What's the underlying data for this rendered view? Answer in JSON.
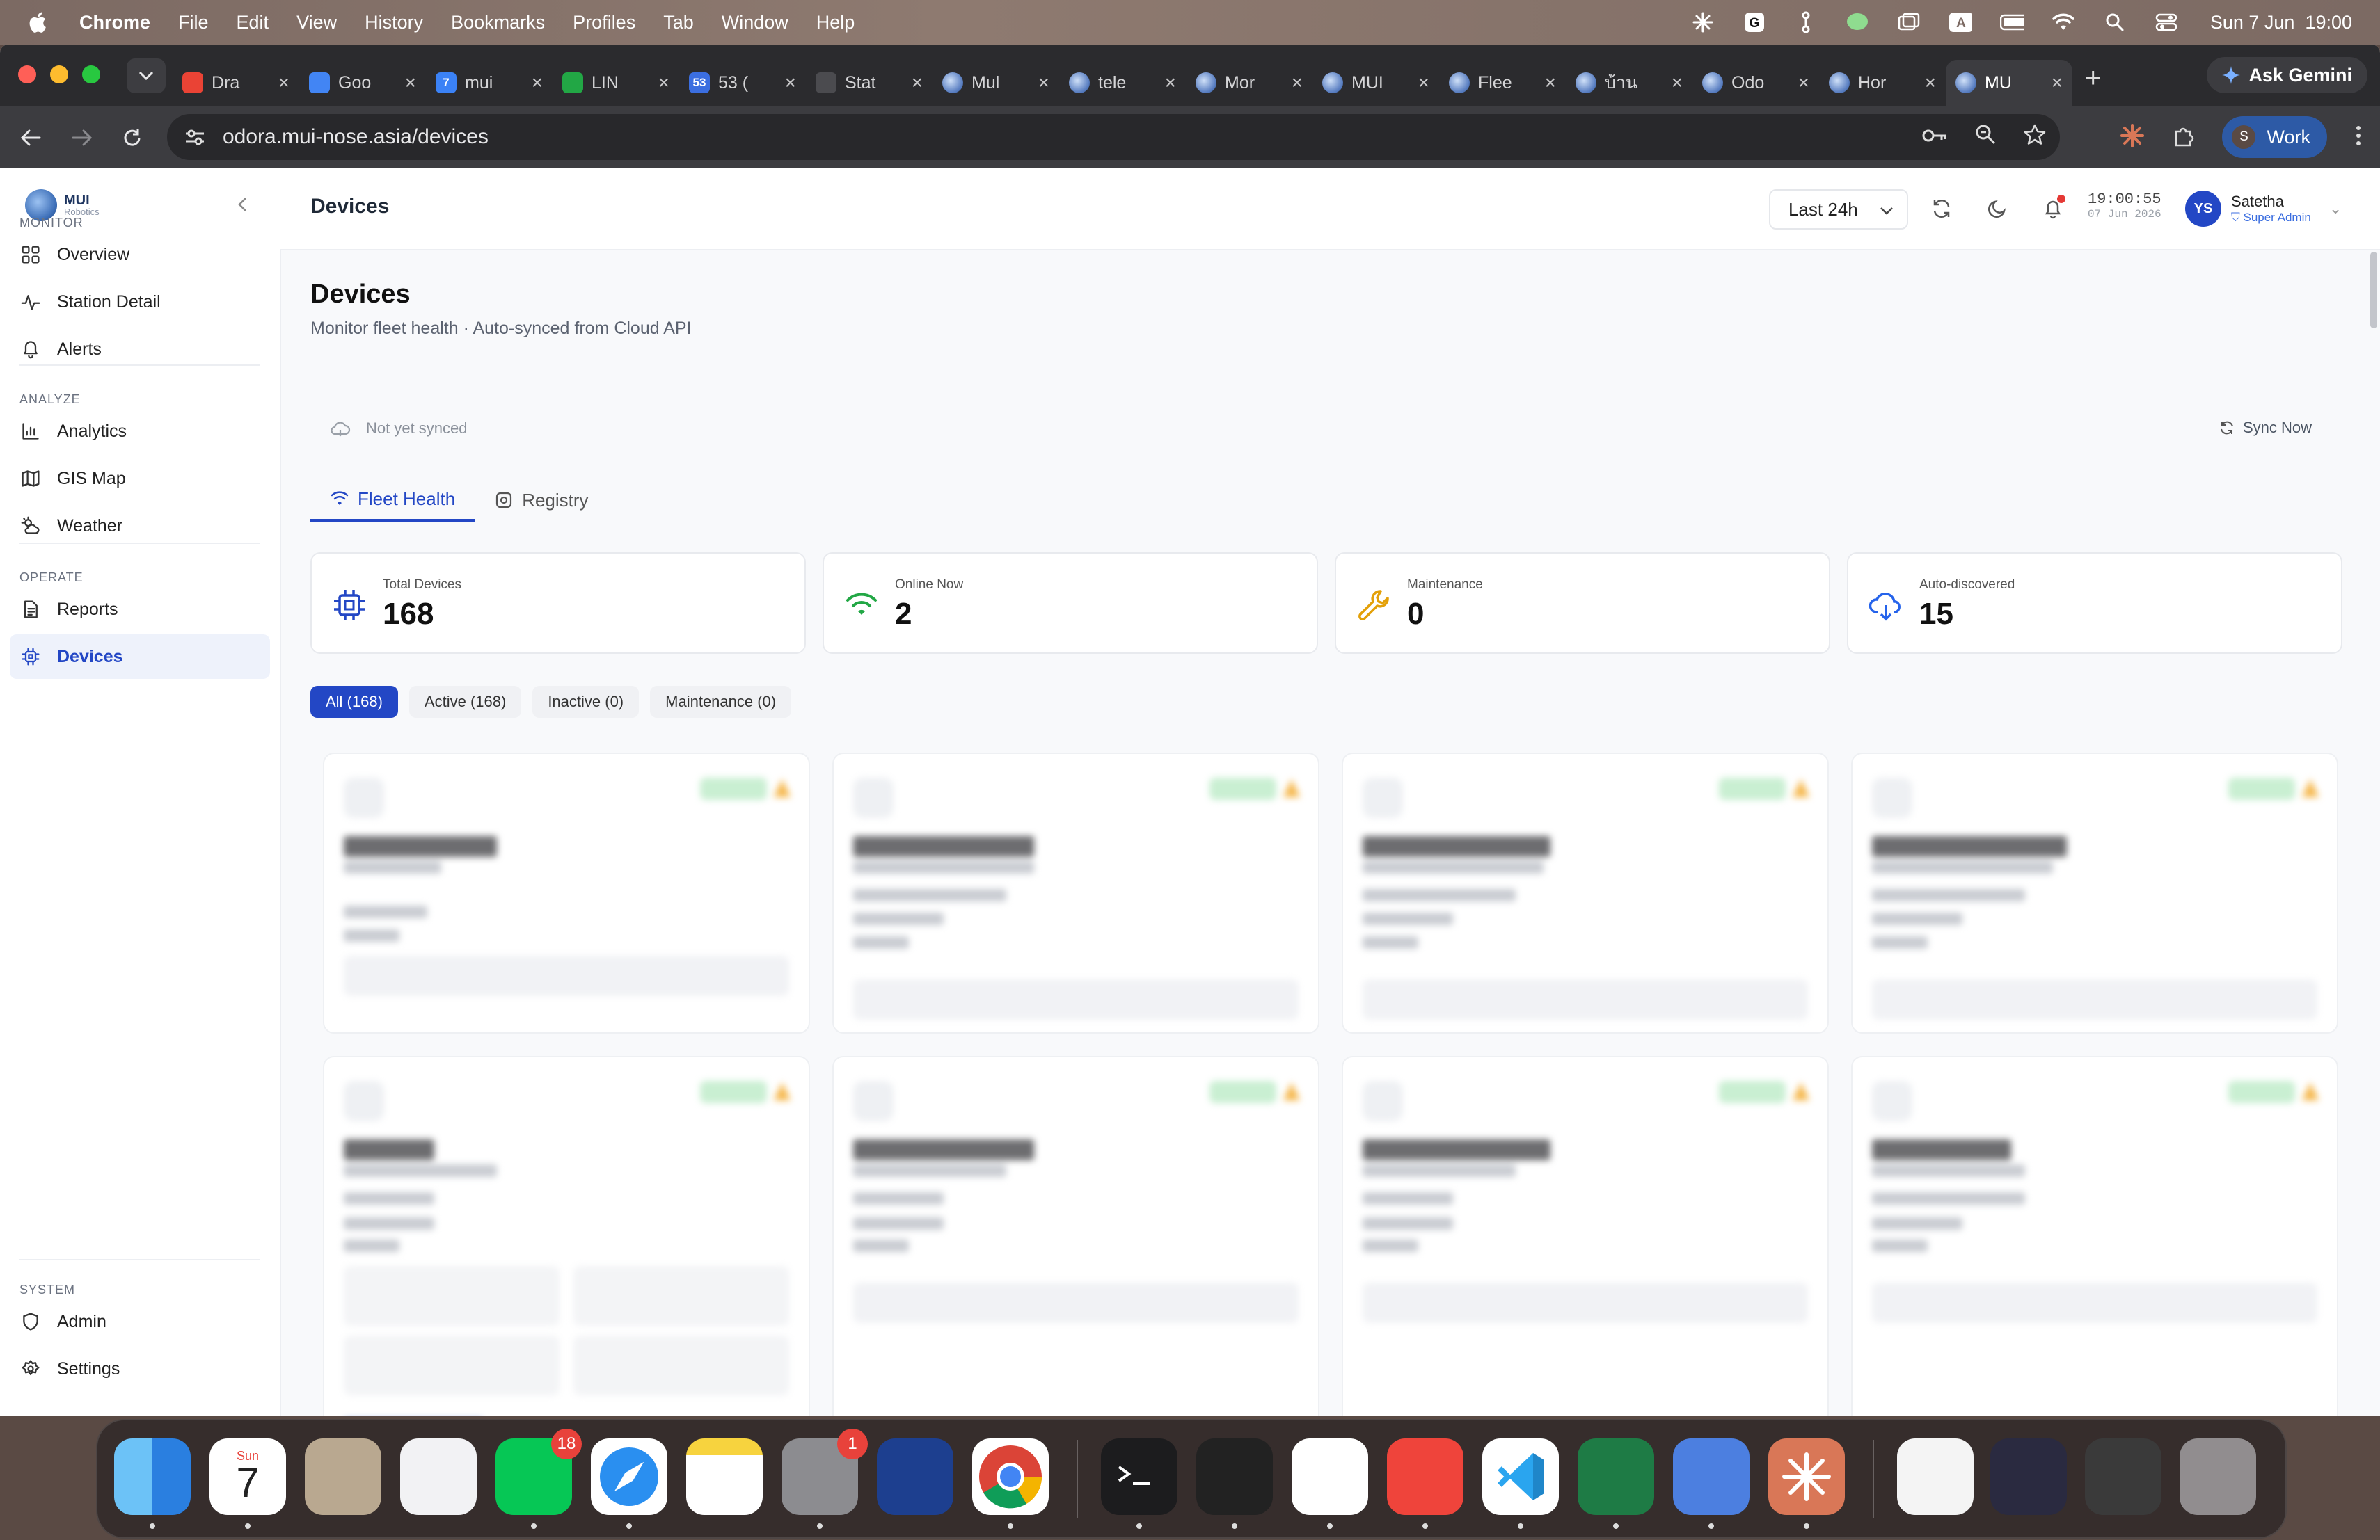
{
  "menubar": {
    "app": "Chrome",
    "items": [
      "File",
      "Edit",
      "View",
      "History",
      "Bookmarks",
      "Profiles",
      "Tab",
      "Window",
      "Help"
    ],
    "datetime": "Sun 7 Jun  19:00",
    "input_indicator": "A"
  },
  "browser": {
    "tabs": [
      {
        "label": "Dra",
        "favicon": "gmail-icon",
        "color": "#ea4335"
      },
      {
        "label": "Goo",
        "favicon": "google-docs-icon",
        "color": "#4285f4"
      },
      {
        "label": "mui",
        "favicon": "page-7-icon",
        "color": "#3b82f6",
        "glyph": "7"
      },
      {
        "label": "LIN",
        "favicon": "line-shield-icon",
        "color": "#22a745"
      },
      {
        "label": "53 (",
        "favicon": "count-icon",
        "color": "#3b6ee0",
        "glyph": "53"
      },
      {
        "label": "Stat",
        "favicon": "circle-icon",
        "color": "#4b4b4f"
      },
      {
        "label": "Mul",
        "favicon": "mui-globe-icon",
        "color": "#5a7fc2"
      },
      {
        "label": "tele",
        "favicon": "mui-globe-icon",
        "color": "#5a7fc2"
      },
      {
        "label": "Mor",
        "favicon": "mui-globe-icon",
        "color": "#5a7fc2"
      },
      {
        "label": "MUI",
        "favicon": "mui-globe-icon",
        "color": "#5a7fc2"
      },
      {
        "label": "Flee",
        "favicon": "mui-globe-icon",
        "color": "#5a7fc2"
      },
      {
        "label": "บ้าน",
        "favicon": "mui-globe-icon",
        "color": "#5a7fc2"
      },
      {
        "label": "Odo",
        "favicon": "mui-globe-icon",
        "color": "#5a7fc2"
      },
      {
        "label": "Hor",
        "favicon": "mui-globe-icon",
        "color": "#5a7fc2"
      },
      {
        "label": "MU",
        "favicon": "mui-globe-icon",
        "color": "#5a7fc2",
        "active": true
      }
    ],
    "new_tab": "+",
    "ask_gemini": "Ask Gemini",
    "url": "odora.mui-nose.asia/devices",
    "profile_label": "Work",
    "profile_initial": "S"
  },
  "sidebar": {
    "logo_name": "MUI",
    "logo_sub": "Robotics",
    "sections": [
      {
        "label": "MONITOR",
        "items": [
          {
            "label": "Overview",
            "icon": "grid-icon"
          },
          {
            "label": "Station Detail",
            "icon": "activity-icon"
          },
          {
            "label": "Alerts",
            "icon": "bell-icon"
          }
        ]
      },
      {
        "label": "ANALYZE",
        "items": [
          {
            "label": "Analytics",
            "icon": "bar-chart-icon"
          },
          {
            "label": "GIS Map",
            "icon": "map-icon"
          },
          {
            "label": "Weather",
            "icon": "cloud-sun-icon"
          }
        ]
      },
      {
        "label": "OPERATE",
        "items": [
          {
            "label": "Reports",
            "icon": "document-icon"
          },
          {
            "label": "Devices",
            "icon": "chip-icon",
            "active": true
          }
        ]
      },
      {
        "label": "SYSTEM",
        "items": [
          {
            "label": "Admin",
            "icon": "shield-icon"
          },
          {
            "label": "Settings",
            "icon": "gear-icon"
          }
        ]
      }
    ]
  },
  "header": {
    "title": "Devices",
    "range": "Last 24h",
    "clock_time": "19:00:55",
    "clock_date": "07 Jun 2026",
    "user_initials": "YS",
    "user_name": "Satetha",
    "user_role": "Super Admin"
  },
  "main": {
    "title": "Devices",
    "subtitle": "Monitor fleet health · Auto-synced from Cloud API",
    "sync_status": "Not yet synced",
    "sync_button": "Sync Now",
    "tabs": [
      {
        "label": "Fleet Health",
        "icon": "wifi-icon",
        "active": true
      },
      {
        "label": "Registry",
        "icon": "gear-icon"
      }
    ],
    "stats": [
      {
        "label": "Total Devices",
        "value": "168",
        "icon": "chip-icon",
        "color": "#2347c5"
      },
      {
        "label": "Online Now",
        "value": "2",
        "icon": "wifi-icon",
        "color": "#22a745"
      },
      {
        "label": "Maintenance",
        "value": "0",
        "icon": "wrench-icon",
        "color": "#e3a008"
      },
      {
        "label": "Auto-discovered",
        "value": "15",
        "icon": "cloud-download-icon",
        "color": "#2563eb"
      }
    ],
    "filters": [
      {
        "label": "All (168)",
        "active": true
      },
      {
        "label": "Active (168)"
      },
      {
        "label": "Inactive (0)"
      },
      {
        "label": "Maintenance (0)"
      }
    ]
  },
  "colors": {
    "accent": "#2347c5",
    "active_badge": "#c9efd2",
    "warning": "#f5b649"
  }
}
